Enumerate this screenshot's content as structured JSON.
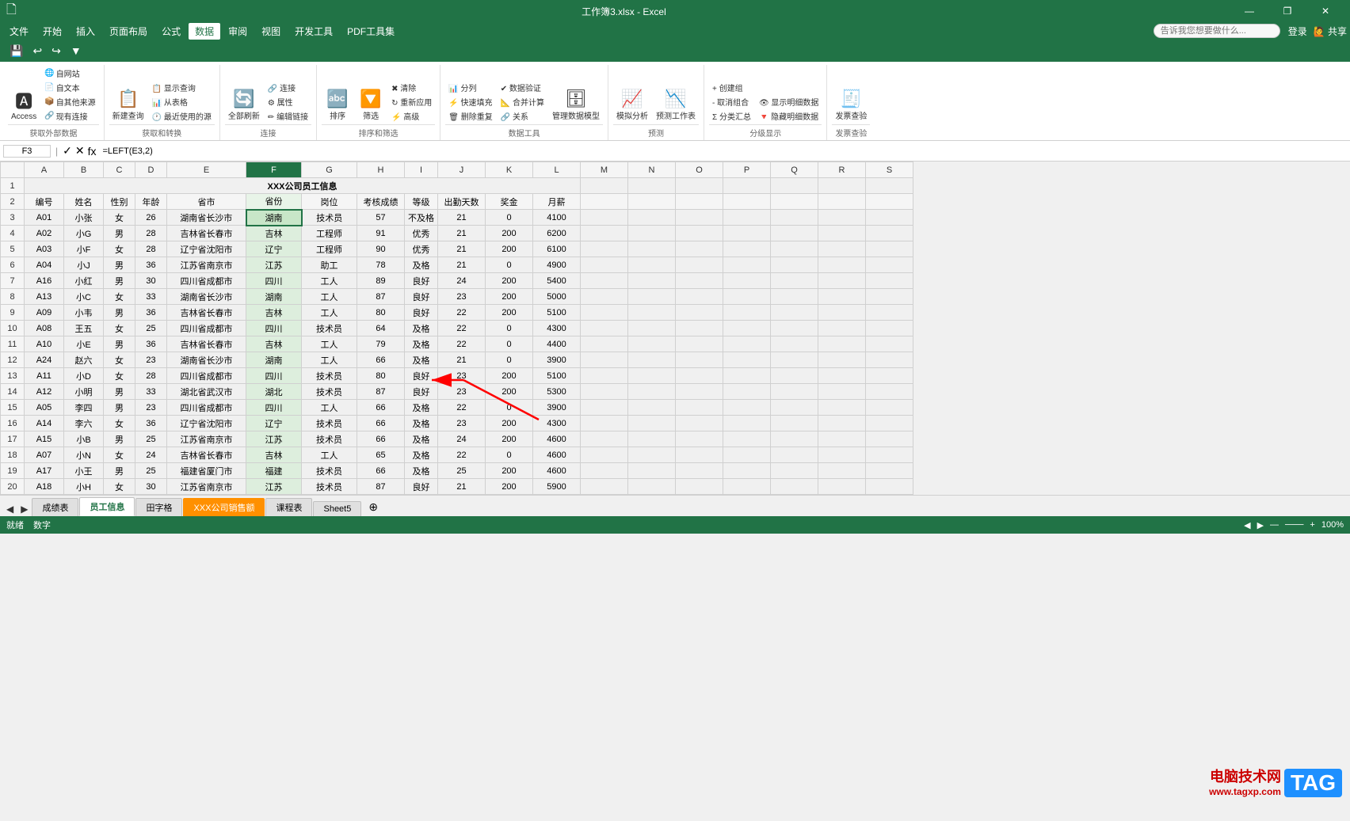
{
  "titleBar": {
    "title": "工作簿3.xlsx - Excel",
    "minBtn": "—",
    "maxBtn": "❐",
    "closeBtn": "✕",
    "icon": "🗋"
  },
  "menuBar": {
    "items": [
      "文件",
      "开始",
      "插入",
      "页面布局",
      "公式",
      "数据",
      "审阅",
      "视图",
      "开发工具",
      "PDF工具集"
    ],
    "activeItem": "数据",
    "searchPlaceholder": "告诉我您想要做什么...",
    "rightItems": [
      "登录",
      "共享"
    ]
  },
  "ribbon": {
    "groups": [
      {
        "label": "获取外部数据",
        "items": [
          "Access",
          "自网站",
          "自文本",
          "自其他来源",
          "现有连接"
        ]
      },
      {
        "label": "获取和转换",
        "items": [
          "新建查询",
          "显示查询",
          "从表格",
          "最近使用的源"
        ]
      },
      {
        "label": "连接",
        "items": [
          "全部刷新",
          "连接",
          "属性",
          "编辑链接"
        ]
      },
      {
        "label": "排序和筛选",
        "items": [
          "排序",
          "筛选",
          "清除",
          "重新应用",
          "高级"
        ]
      },
      {
        "label": "数据工具",
        "items": [
          "分列",
          "快速填充",
          "删除重复",
          "数据验证",
          "合并计算",
          "关系",
          "管理数据模型"
        ]
      },
      {
        "label": "预测",
        "items": [
          "模拟分析",
          "预测工作表"
        ]
      },
      {
        "label": "分级显示",
        "items": [
          "创建组",
          "取消组合",
          "分类汇总",
          "显示明细数据",
          "隐藏明细数据"
        ]
      },
      {
        "label": "发票查验",
        "items": [
          "发票查验"
        ]
      }
    ]
  },
  "quickAccess": {
    "buttons": [
      "💾",
      "↩",
      "↪",
      "⬛"
    ]
  },
  "formulaBar": {
    "cellRef": "F3",
    "formula": "=LEFT(E3,2)"
  },
  "columnHeaders": [
    "",
    "A",
    "B",
    "C",
    "D",
    "E",
    "F",
    "G",
    "H",
    "I",
    "J",
    "K",
    "L",
    "M",
    "N",
    "O",
    "P",
    "Q",
    "R",
    "S"
  ],
  "spreadsheet": {
    "mergedTitle": "XXX公司员工信息",
    "dataHeaders": [
      "编号",
      "姓名",
      "性别",
      "年龄",
      "省市",
      "省份",
      "岗位",
      "考核成绩",
      "等级",
      "出勤天数",
      "奖金",
      "月薪"
    ],
    "rows": [
      [
        "A01",
        "小张",
        "女",
        "26",
        "湖南省长沙市",
        "湖南",
        "技术员",
        "57",
        "不及格",
        "21",
        "0",
        "4100"
      ],
      [
        "A02",
        "小G",
        "男",
        "28",
        "吉林省长春市",
        "吉林",
        "工程师",
        "91",
        "优秀",
        "21",
        "200",
        "6200"
      ],
      [
        "A03",
        "小F",
        "女",
        "28",
        "辽宁省沈阳市",
        "辽宁",
        "工程师",
        "90",
        "优秀",
        "21",
        "200",
        "6100"
      ],
      [
        "A04",
        "小J",
        "男",
        "36",
        "江苏省南京市",
        "江苏",
        "助工",
        "78",
        "及格",
        "21",
        "0",
        "4900"
      ],
      [
        "A16",
        "小红",
        "男",
        "30",
        "四川省成都市",
        "四川",
        "工人",
        "89",
        "良好",
        "24",
        "200",
        "5400"
      ],
      [
        "A13",
        "小C",
        "女",
        "33",
        "湖南省长沙市",
        "湖南",
        "工人",
        "87",
        "良好",
        "23",
        "200",
        "5000"
      ],
      [
        "A09",
        "小韦",
        "男",
        "36",
        "吉林省长春市",
        "吉林",
        "工人",
        "80",
        "良好",
        "22",
        "200",
        "5100"
      ],
      [
        "A08",
        "王五",
        "女",
        "25",
        "四川省成都市",
        "四川",
        "技术员",
        "64",
        "及格",
        "22",
        "0",
        "4300"
      ],
      [
        "A10",
        "小E",
        "男",
        "36",
        "吉林省长春市",
        "吉林",
        "工人",
        "79",
        "及格",
        "22",
        "0",
        "4400"
      ],
      [
        "A24",
        "赵六",
        "女",
        "23",
        "湖南省长沙市",
        "湖南",
        "工人",
        "66",
        "及格",
        "21",
        "0",
        "3900"
      ],
      [
        "A11",
        "小D",
        "女",
        "28",
        "四川省成都市",
        "四川",
        "技术员",
        "80",
        "良好",
        "23",
        "200",
        "5100"
      ],
      [
        "A12",
        "小明",
        "男",
        "33",
        "湖北省武汉市",
        "湖北",
        "技术员",
        "87",
        "良好",
        "23",
        "200",
        "5300"
      ],
      [
        "A05",
        "李四",
        "男",
        "23",
        "四川省成都市",
        "四川",
        "工人",
        "66",
        "及格",
        "22",
        "0",
        "3900"
      ],
      [
        "A14",
        "李六",
        "女",
        "36",
        "辽宁省沈阳市",
        "辽宁",
        "技术员",
        "66",
        "及格",
        "23",
        "200",
        "4300"
      ],
      [
        "A15",
        "小B",
        "男",
        "25",
        "江苏省南京市",
        "江苏",
        "技术员",
        "66",
        "及格",
        "24",
        "200",
        "4600"
      ],
      [
        "A07",
        "小N",
        "女",
        "24",
        "吉林省长春市",
        "吉林",
        "工人",
        "65",
        "及格",
        "22",
        "0",
        "4600"
      ],
      [
        "A17",
        "小王",
        "男",
        "25",
        "福建省厦门市",
        "福建",
        "技术员",
        "66",
        "及格",
        "25",
        "200",
        "4600"
      ],
      [
        "A18",
        "小H",
        "女",
        "30",
        "江苏省南京市",
        "江苏",
        "技术员",
        "87",
        "良好",
        "21",
        "200",
        "5900"
      ]
    ]
  },
  "sheetTabs": {
    "tabs": [
      "成绩表",
      "员工信息",
      "田字格",
      "XXX公司销售额",
      "课程表",
      "Sheet5"
    ],
    "activeTab": "员工信息",
    "orangeTab": "XXX公司销售额",
    "addBtn": "+"
  },
  "statusBar": {
    "left": [
      "就绪",
      "数字"
    ],
    "right": [
      "◀",
      "▶",
      "▲",
      "▼",
      "100%"
    ]
  },
  "watermark": {
    "text": "电脑技术网",
    "tag": "TAG",
    "url": "www.tagxp.com"
  }
}
